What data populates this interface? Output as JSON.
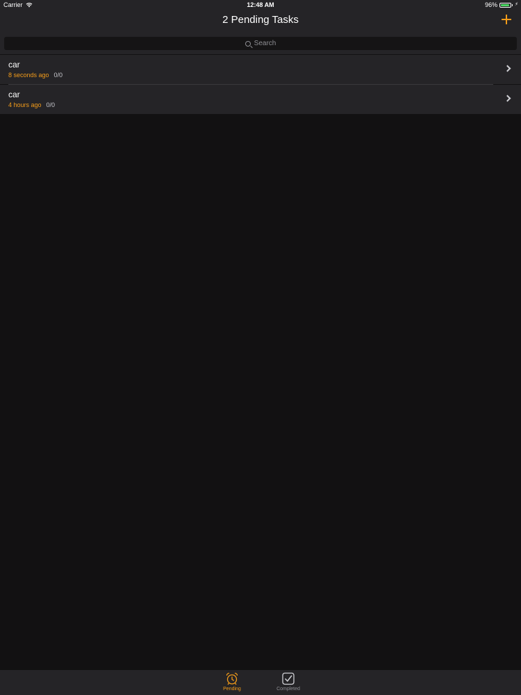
{
  "status_bar": {
    "carrier": "Carrier",
    "time": "12:48 AM",
    "battery": "96%",
    "battery_level": 0.96
  },
  "nav": {
    "title": "2 Pending Tasks",
    "add_icon": "plus-icon"
  },
  "search": {
    "placeholder": "Search"
  },
  "tasks": [
    {
      "title": "car",
      "time": "8 seconds ago",
      "progress": "0/0"
    },
    {
      "title": "car",
      "time": "4 hours ago",
      "progress": "0/0"
    }
  ],
  "tabs": [
    {
      "label": "Pending",
      "icon": "alarm-clock-icon",
      "active": true
    },
    {
      "label": "Completed",
      "icon": "checkbox-icon",
      "active": false
    }
  ],
  "colors": {
    "accent": "#f39c1a",
    "bar_background": "#252427",
    "page_background": "#121112",
    "battery_green": "#4cd964"
  }
}
